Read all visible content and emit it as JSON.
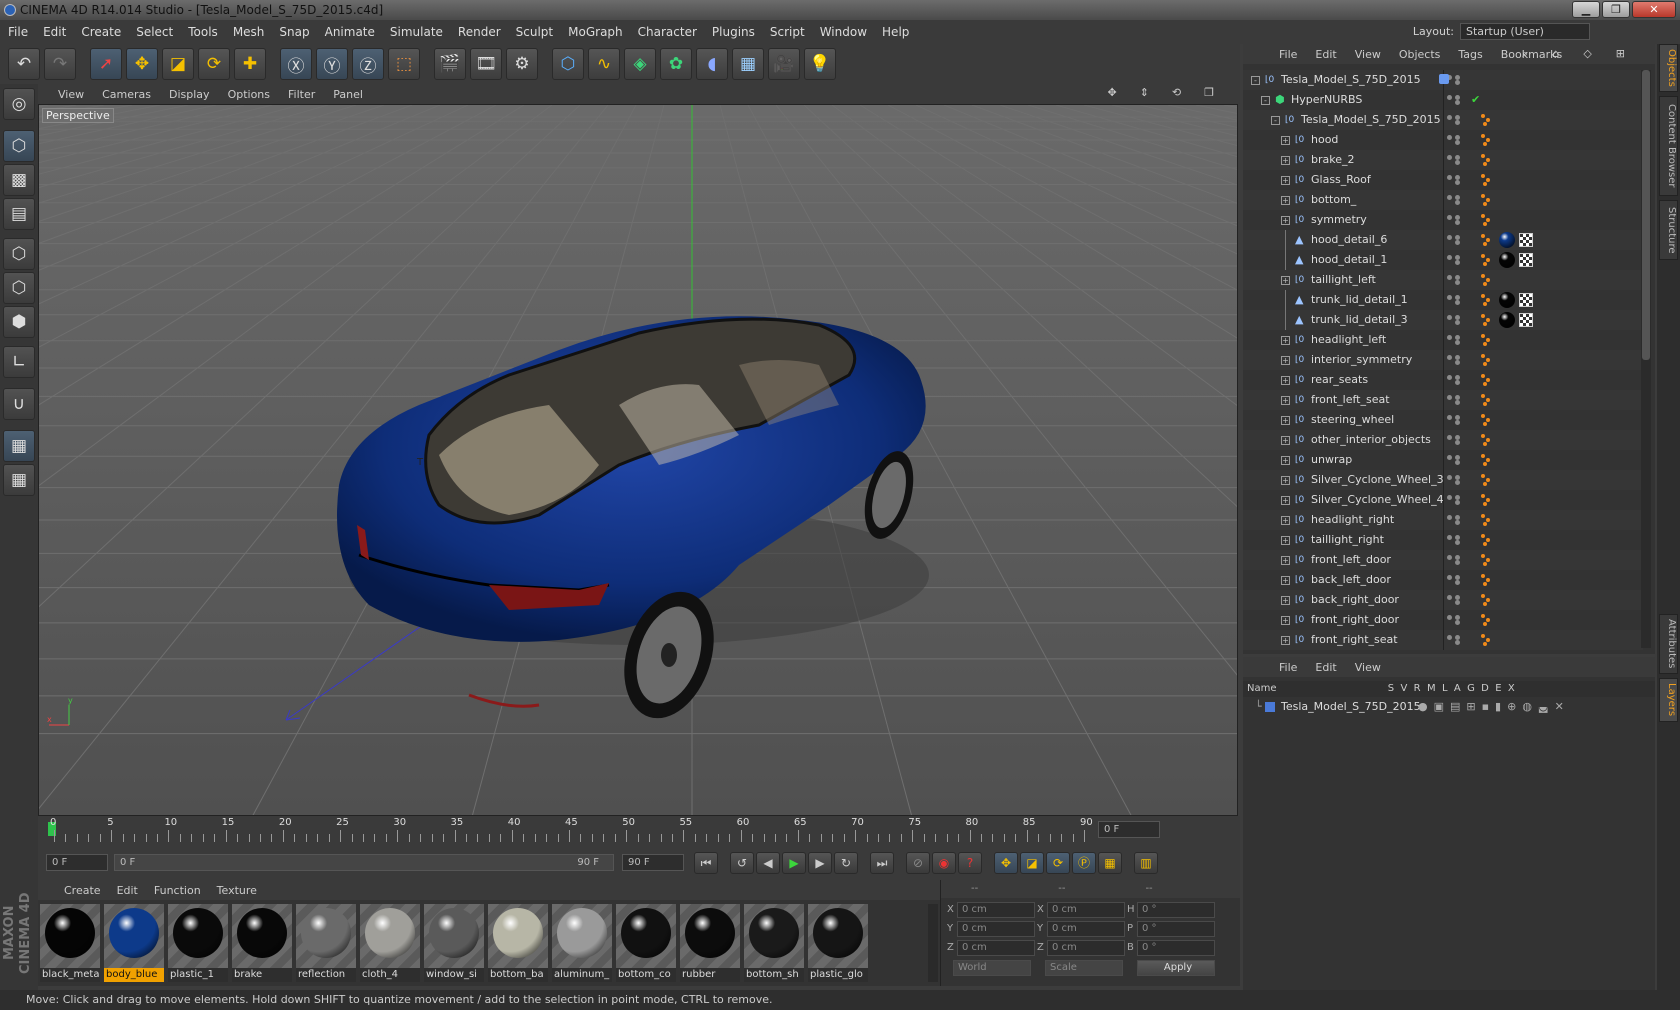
{
  "window": {
    "title": "CINEMA 4D R14.014 Studio - [Tesla_Model_S_75D_2015.c4d]"
  },
  "menu": [
    "File",
    "Edit",
    "Create",
    "Select",
    "Tools",
    "Mesh",
    "Snap",
    "Animate",
    "Simulate",
    "Render",
    "Sculpt",
    "MoGraph",
    "Character",
    "Plugins",
    "Script",
    "Window",
    "Help"
  ],
  "layout": {
    "label": "Layout:",
    "value": "Startup (User)"
  },
  "viewport": {
    "menu": [
      "View",
      "Cameras",
      "Display",
      "Options",
      "Filter",
      "Panel"
    ],
    "label": "Perspective"
  },
  "timeline": {
    "ticks": [
      "0",
      "5",
      "10",
      "15",
      "20",
      "25",
      "30",
      "35",
      "40",
      "45",
      "50",
      "55",
      "60",
      "65",
      "70",
      "75",
      "80",
      "85",
      "90"
    ],
    "frame_display": "0 F",
    "start": "0 F",
    "range_start": "0 F",
    "range_end": "90 F",
    "end": "90 F"
  },
  "materials": {
    "menu": [
      "Create",
      "Edit",
      "Function",
      "Texture"
    ],
    "items": [
      {
        "name": "black_meta",
        "color": "#050505"
      },
      {
        "name": "body_blue",
        "color": "#0d3a8a",
        "selected": true
      },
      {
        "name": "plastic_1",
        "color": "#0a0a0a"
      },
      {
        "name": "brake",
        "color": "#080808"
      },
      {
        "name": "reflection",
        "color": "#6a6a6a"
      },
      {
        "name": "cloth_4",
        "color": "#a09f9a"
      },
      {
        "name": "window_si",
        "color": "#5a5a5a"
      },
      {
        "name": "bottom_ba",
        "color": "#b7b6a6"
      },
      {
        "name": "aluminum_",
        "color": "#9a9a9a"
      },
      {
        "name": "bottom_co",
        "color": "#111111"
      },
      {
        "name": "rubber",
        "color": "#0c0c0c"
      },
      {
        "name": "bottom_sh",
        "color": "#1a1a1a"
      },
      {
        "name": "plastic_glo",
        "color": "#151515"
      }
    ]
  },
  "attributes": {
    "head": [
      "--",
      "--",
      "--"
    ],
    "rows": [
      {
        "a": "X",
        "av": "0 cm",
        "b": "X",
        "bv": "0 cm",
        "c": "H",
        "cv": "0 °"
      },
      {
        "a": "Y",
        "av": "0 cm",
        "b": "Y",
        "bv": "0 cm",
        "c": "P",
        "cv": "0 °"
      },
      {
        "a": "Z",
        "av": "0 cm",
        "b": "Z",
        "bv": "0 cm",
        "c": "B",
        "cv": "0 °"
      }
    ],
    "world": "World",
    "scale": "Scale",
    "apply": "Apply"
  },
  "objects": {
    "menu": [
      "File",
      "Edit",
      "View",
      "Objects",
      "Tags",
      "Bookmarks"
    ],
    "tree": [
      {
        "name": "Tesla_Model_S_75D_2015",
        "level": 0,
        "type": "null",
        "exp": "-"
      },
      {
        "name": "HyperNURBS",
        "level": 1,
        "type": "nurbs",
        "exp": "-"
      },
      {
        "name": "Tesla_Model_S_75D_2015",
        "level": 2,
        "type": "null",
        "exp": "-"
      },
      {
        "name": "hood",
        "level": 3,
        "type": "null",
        "exp": "+"
      },
      {
        "name": "brake_2",
        "level": 3,
        "type": "null",
        "exp": "+"
      },
      {
        "name": "Glass_Roof",
        "level": 3,
        "type": "null",
        "exp": "+"
      },
      {
        "name": "bottom_",
        "level": 3,
        "type": "null",
        "exp": "+"
      },
      {
        "name": "symmetry",
        "level": 3,
        "type": "null",
        "exp": "+"
      },
      {
        "name": "hood_detail_6",
        "level": 3,
        "type": "poly",
        "mat": "#0d3a8a"
      },
      {
        "name": "hood_detail_1",
        "level": 3,
        "type": "poly",
        "mat": "#050505"
      },
      {
        "name": "taillight_left",
        "level": 3,
        "type": "null",
        "exp": "+"
      },
      {
        "name": "trunk_lid_detail_1",
        "level": 3,
        "type": "poly",
        "mat": "#050505"
      },
      {
        "name": "trunk_lid_detail_3",
        "level": 3,
        "type": "poly",
        "mat": "#050505"
      },
      {
        "name": "headlight_left",
        "level": 3,
        "type": "null",
        "exp": "+"
      },
      {
        "name": "interior_symmetry",
        "level": 3,
        "type": "null",
        "exp": "+"
      },
      {
        "name": "rear_seats",
        "level": 3,
        "type": "null",
        "exp": "+"
      },
      {
        "name": "front_left_seat",
        "level": 3,
        "type": "null",
        "exp": "+"
      },
      {
        "name": "steering_wheel",
        "level": 3,
        "type": "null",
        "exp": "+"
      },
      {
        "name": "other_interior_objects",
        "level": 3,
        "type": "null",
        "exp": "+"
      },
      {
        "name": "unwrap",
        "level": 3,
        "type": "null",
        "exp": "+"
      },
      {
        "name": "Silver_Cyclone_Wheel_3",
        "level": 3,
        "type": "null",
        "exp": "+"
      },
      {
        "name": "Silver_Cyclone_Wheel_4",
        "level": 3,
        "type": "null",
        "exp": "+"
      },
      {
        "name": "headlight_right",
        "level": 3,
        "type": "null",
        "exp": "+"
      },
      {
        "name": "taillight_right",
        "level": 3,
        "type": "null",
        "exp": "+"
      },
      {
        "name": "front_left_door",
        "level": 3,
        "type": "null",
        "exp": "+"
      },
      {
        "name": "back_left_door",
        "level": 3,
        "type": "null",
        "exp": "+"
      },
      {
        "name": "back_right_door",
        "level": 3,
        "type": "null",
        "exp": "+"
      },
      {
        "name": "front_right_door",
        "level": 3,
        "type": "null",
        "exp": "+"
      },
      {
        "name": "front_right_seat",
        "level": 3,
        "type": "null",
        "exp": "+"
      }
    ]
  },
  "layers": {
    "menu": [
      "File",
      "Edit",
      "View"
    ],
    "columns": "Name                                   S  V  R  M  L  A  G  D  E  X",
    "row": "Tesla_Model_S_75D_2015"
  },
  "sidetabs": [
    "Objects",
    "Content Browser",
    "Structure",
    "Attributes",
    "Layers"
  ],
  "brand": "MAXON CINEMA 4D",
  "status": "Move: Click and drag to move elements. Hold down SHIFT to quantize movement / add to the selection in point mode, CTRL to remove."
}
